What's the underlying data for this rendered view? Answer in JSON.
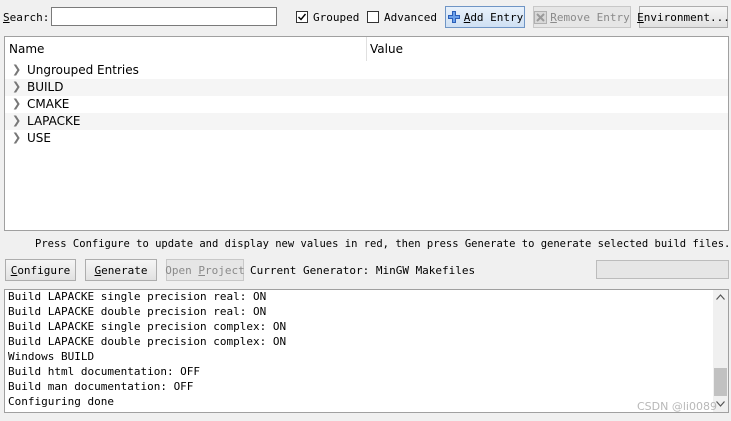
{
  "toolbar": {
    "search_label_prefix": "",
    "search_label_underlined": "S",
    "search_label_suffix": "earch:",
    "search_value": "",
    "grouped_label": "Grouped",
    "grouped_checked": true,
    "advanced_label": "Advanced",
    "advanced_checked": false,
    "add_entry_underlined": "A",
    "add_entry_suffix": "dd Entry",
    "remove_entry_underlined": "R",
    "remove_entry_suffix": "emove Entry",
    "environment_underlined": "E",
    "environment_suffix": "nvironment..."
  },
  "tree": {
    "columns": [
      "Name",
      "Value"
    ],
    "rows": [
      {
        "label": "Ungrouped Entries"
      },
      {
        "label": "BUILD"
      },
      {
        "label": "CMAKE"
      },
      {
        "label": "LAPACKE"
      },
      {
        "label": "USE"
      }
    ]
  },
  "hint": "Press Configure to update and display new values in red, then press Generate to generate selected build files.",
  "actions": {
    "configure_underlined": "C",
    "configure_suffix": "onfigure",
    "generate_underlined": "G",
    "generate_suffix": "enerate",
    "open_project_prefix": "Open ",
    "open_project_underlined": "P",
    "open_project_suffix": "roject",
    "current_generator": "Current Generator: MinGW Makefiles"
  },
  "log": {
    "lines": [
      "Build LAPACKE single precision real: ON",
      "Build LAPACKE double precision real: ON",
      "Build LAPACKE single precision complex: ON",
      "Build LAPACKE double precision complex: ON",
      "Windows BUILD",
      "Build html documentation: OFF",
      "Build man documentation: OFF",
      "Configuring done"
    ]
  },
  "watermark": "CSDN @li0089"
}
